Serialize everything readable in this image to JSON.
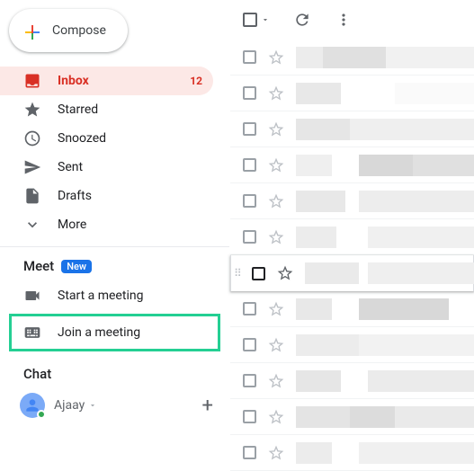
{
  "compose": {
    "label": "Compose"
  },
  "nav": {
    "items": [
      {
        "label": "Inbox",
        "count": "12",
        "active": true
      },
      {
        "label": "Starred"
      },
      {
        "label": "Snoozed"
      },
      {
        "label": "Sent"
      },
      {
        "label": "Drafts"
      },
      {
        "label": "More"
      }
    ]
  },
  "meet": {
    "header": "Meet",
    "badge": "New",
    "items": [
      {
        "label": "Start a meeting"
      },
      {
        "label": "Join a meeting"
      }
    ]
  },
  "chat": {
    "header": "Chat",
    "user": "Ajaay"
  }
}
